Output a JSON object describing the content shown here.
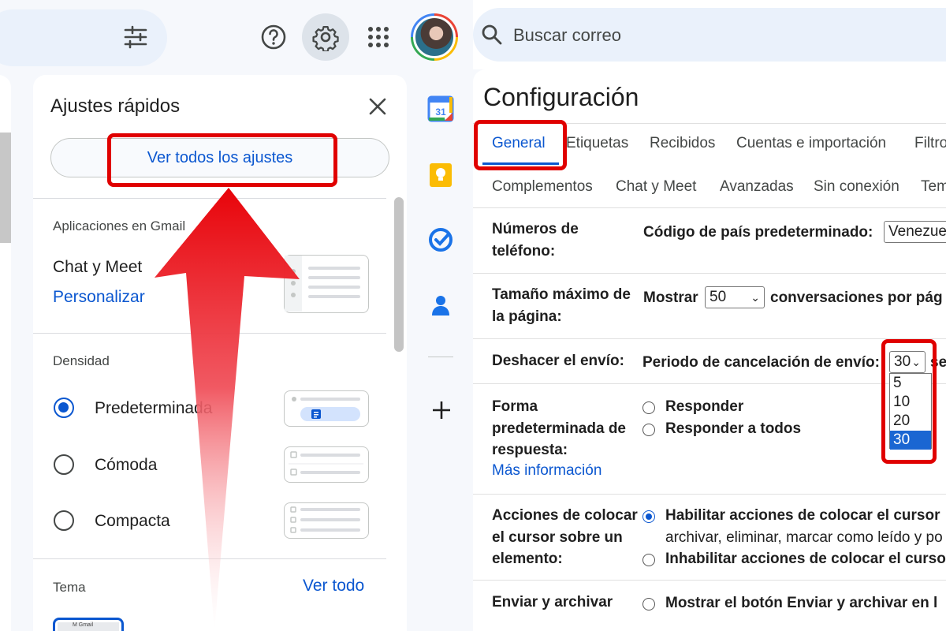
{
  "left": {
    "quick_settings": {
      "title": "Ajustes rápidos",
      "see_all_button": "Ver todos los ajustes",
      "apps_section": {
        "label": "Aplicaciones en Gmail",
        "item": "Chat y Meet",
        "customize": "Personalizar"
      },
      "density": {
        "label": "Densidad",
        "options": [
          {
            "label": "Predeterminada",
            "selected": true
          },
          {
            "label": "Cómoda",
            "selected": false
          },
          {
            "label": "Compacta",
            "selected": false
          }
        ]
      },
      "theme": {
        "label": "Tema",
        "see_all": "Ver todo",
        "thumb_text": "M Gmail"
      }
    },
    "calendar_day": "31"
  },
  "right": {
    "search_placeholder": "Buscar correo",
    "title": "Configuración",
    "tabs_row1": [
      "General",
      "Etiquetas",
      "Recibidos",
      "Cuentas e importación",
      "Filtro"
    ],
    "tabs_row2": [
      "Complementos",
      "Chat y Meet",
      "Avanzadas",
      "Sin conexión",
      "Tem"
    ],
    "active_tab": "General",
    "rows": {
      "phone": {
        "label_line1": "Números de",
        "label_line2": "teléfono:",
        "field_label": "Código de país predeterminado:",
        "field_value": "Venezue"
      },
      "page_size": {
        "label_line1": "Tamaño máximo de",
        "label_line2": "la página:",
        "prefix": "Mostrar",
        "value": "50",
        "suffix": "conversaciones por pág"
      },
      "undo_send": {
        "label": "Deshacer el envío:",
        "field_label": "Periodo de cancelación de envío:",
        "value": "30",
        "suffix": "se",
        "options": [
          "5",
          "10",
          "20",
          "30"
        ]
      },
      "reply": {
        "label_line1": "Forma",
        "label_line2": "predeterminada de",
        "label_line3": "respuesta:",
        "more_info": "Más información",
        "option1": "Responder",
        "option2": "Responder a todos"
      },
      "hover": {
        "label_line1": "Acciones de colocar",
        "label_line2": "el cursor sobre un",
        "label_line3": "elemento:",
        "option1": "Habilitar acciones de colocar el cursor",
        "option1_desc": "archivar, eliminar, marcar como leído y po",
        "option2": "Inhabilitar acciones de colocar el curso"
      },
      "send_archive": {
        "label": "Enviar y archivar",
        "option1": "Mostrar el botón Enviar y archivar en l"
      }
    }
  },
  "colors": {
    "highlight_red": "#e00000",
    "accent_blue": "#0b57d0"
  }
}
